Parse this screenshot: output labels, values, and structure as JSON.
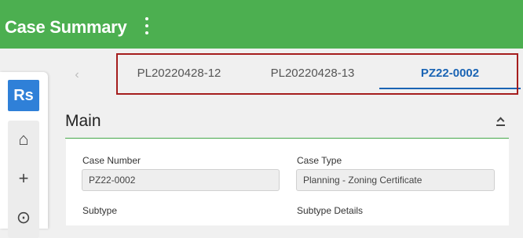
{
  "header": {
    "title": "Case Summary",
    "menu_icon": "more-vertical-icon"
  },
  "rail": {
    "logo": "Rs",
    "items": [
      {
        "icon": "home-icon",
        "glyph": "⌂"
      },
      {
        "icon": "plus-icon",
        "glyph": "+"
      },
      {
        "icon": "search-icon",
        "glyph": "⊙"
      }
    ]
  },
  "tabs": {
    "prev_glyph": "‹",
    "items": [
      {
        "label": "PL20220428-12"
      },
      {
        "label": "PL20220428-13"
      },
      {
        "label": "PZ22-0002"
      }
    ],
    "active": "PZ22-0002"
  },
  "section": {
    "title": "Main"
  },
  "fields": {
    "case_number": {
      "label": "Case Number",
      "value": "PZ22-0002"
    },
    "case_type": {
      "label": "Case Type",
      "value": "Planning - Zoning Certificate"
    },
    "subtype": {
      "label": "Subtype"
    },
    "subtype_details": {
      "label": "Subtype Details"
    }
  },
  "colors": {
    "header": "#4caf50",
    "accent": "#1a64b4",
    "logo": "#2f80d8",
    "highlight": "#a51d1d"
  }
}
